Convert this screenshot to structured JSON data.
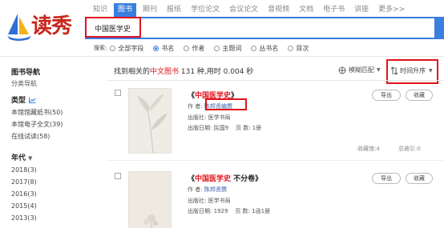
{
  "nav": {
    "tabs": [
      "知识",
      "图书",
      "期刊",
      "报纸",
      "学位论文",
      "会议论文",
      "音视频",
      "文档",
      "电子书",
      "讲座",
      "更多>>"
    ],
    "active_index": 1
  },
  "logo": {
    "text": "读秀"
  },
  "search": {
    "value": "中国医学史",
    "label": "搜索:",
    "options": [
      "全部字段",
      "书名",
      "作者",
      "主题词",
      "丛书名",
      "目次"
    ],
    "selected_index": 1
  },
  "sidebar": {
    "nav_title": "图书导航",
    "nav_link": "分类导航",
    "type_title": "类型",
    "types": [
      "本馆馆藏纸书(50)",
      "本馆电子全文(39)",
      "在线试读(58)"
    ],
    "era_title": "年代",
    "years": [
      "2018(3)",
      "2017(8)",
      "2016(3)",
      "2015(4)",
      "2013(3)"
    ]
  },
  "results": {
    "prefix": "找到相关的",
    "category": "中文图书",
    "count_text": " 131 种,用时 0.004 秒",
    "match_mode": "模糊匹配",
    "sort": "时间升序"
  },
  "items": [
    {
      "title_prefix": "《",
      "title_hl": "中国医学史",
      "title_suffix": "》",
      "author_label": "作 者:",
      "author": "陈邦贤编撰",
      "publisher_label": "出版社:",
      "publisher": "医学书局",
      "date_label": "出版日期:",
      "date": "民国9",
      "pages_label": "页 数:",
      "pages": "1册",
      "holdings": "收藏馆:4",
      "citations": "总被引:0",
      "export_label": "导出",
      "collect_label": "收藏"
    },
    {
      "title_prefix": "《",
      "title_hl": "中国医学史",
      "title_suffix": " 不分卷》",
      "author_label": "作 者:",
      "author": "陈邦贤撰",
      "publisher_label": "出版社:",
      "publisher": "医学书局",
      "date_label": "出版日期:",
      "date": "1929",
      "pages_label": "页 数:",
      "pages": "1函1册",
      "export_label": "导出",
      "collect_label": "收藏"
    }
  ],
  "colors": {
    "accent": "#3a7ee0",
    "highlight": "#e0141c",
    "brand": "#c8261c"
  }
}
